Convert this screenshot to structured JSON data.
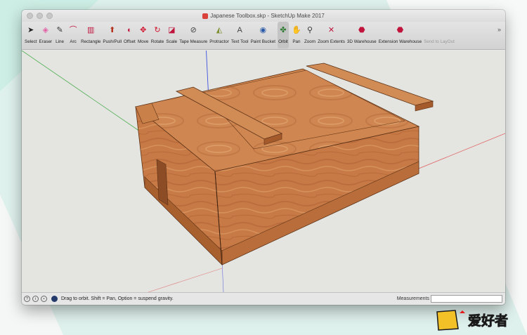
{
  "window": {
    "title": "Japanese Toolbox.skp - SketchUp Make 2017",
    "more_glyph": "»"
  },
  "toolbar": {
    "tools": [
      {
        "label": "Select",
        "icon": "select-arrow-icon",
        "glyph": "➤",
        "color": "#222222"
      },
      {
        "label": "Eraser",
        "icon": "eraser-icon",
        "glyph": "◈",
        "color": "#e35fa5"
      },
      {
        "label": "Line",
        "icon": "pencil-icon",
        "glyph": "✎",
        "color": "#333333"
      },
      {
        "label": "Arc",
        "icon": "arc-icon",
        "glyph": "⌒",
        "color": "#c0143c"
      },
      {
        "label": "Rectangle",
        "icon": "rectangle-icon",
        "glyph": "▥",
        "color": "#c0143c"
      },
      {
        "label": "Push/Pull",
        "icon": "push-pull-icon",
        "glyph": "⬆",
        "color": "#b4331f"
      },
      {
        "label": "Offset",
        "icon": "offset-icon",
        "glyph": "◐",
        "color": "#c0143c"
      },
      {
        "label": "Move",
        "icon": "move-icon",
        "glyph": "✥",
        "color": "#d0102a"
      },
      {
        "label": "Rotate",
        "icon": "rotate-icon",
        "glyph": "↻",
        "color": "#d0102a"
      },
      {
        "label": "Scale",
        "icon": "scale-icon",
        "glyph": "◪",
        "color": "#c0143c"
      },
      {
        "label": "Tape Measure",
        "icon": "tape-measure-icon",
        "glyph": "⊘",
        "color": "#444444"
      },
      {
        "label": "Protractor",
        "icon": "protractor-icon",
        "glyph": "◭",
        "color": "#7d8f32"
      },
      {
        "label": "Text Tool",
        "icon": "text-tool-icon",
        "glyph": "A",
        "color": "#444444"
      },
      {
        "label": "Paint Bucket",
        "icon": "paint-bucket-icon",
        "glyph": "◉",
        "color": "#2b5aa8"
      },
      {
        "label": "Orbit",
        "icon": "orbit-icon",
        "glyph": "✤",
        "color": "#2e7a30"
      },
      {
        "label": "Pan",
        "icon": "pan-hand-icon",
        "glyph": "✋",
        "color": "#d9a21d"
      },
      {
        "label": "Zoom",
        "icon": "zoom-icon",
        "glyph": "⚲",
        "color": "#333333"
      },
      {
        "label": "Zoom Extents",
        "icon": "zoom-extents-icon",
        "glyph": "✕",
        "color": "#c0143c"
      },
      {
        "label": "3D Warehouse",
        "icon": "warehouse-icon",
        "glyph": "⬣",
        "color": "#c0143c"
      },
      {
        "label": "Extension Warehouse",
        "icon": "extension-warehouse-icon",
        "glyph": "⬣",
        "color": "#c0143c"
      },
      {
        "label": "Send to LayOut",
        "icon": "send-to-layout-icon",
        "glyph": "",
        "color": "#999999"
      }
    ]
  },
  "status": {
    "message": "Drag to orbit. Shift = Pan, Option = suspend gravity.",
    "measurements_label": "Measurements",
    "measurements_value": "",
    "icons": [
      {
        "icon": "info-icon",
        "glyph": "?"
      },
      {
        "icon": "credits-icon",
        "glyph": "i"
      },
      {
        "icon": "user-icon",
        "glyph": "•"
      }
    ]
  },
  "watermark": {
    "text": "爱好者",
    "colors": {
      "gold": "#f2c128",
      "red": "#e31b1b",
      "dark": "#1a1a1a"
    }
  }
}
